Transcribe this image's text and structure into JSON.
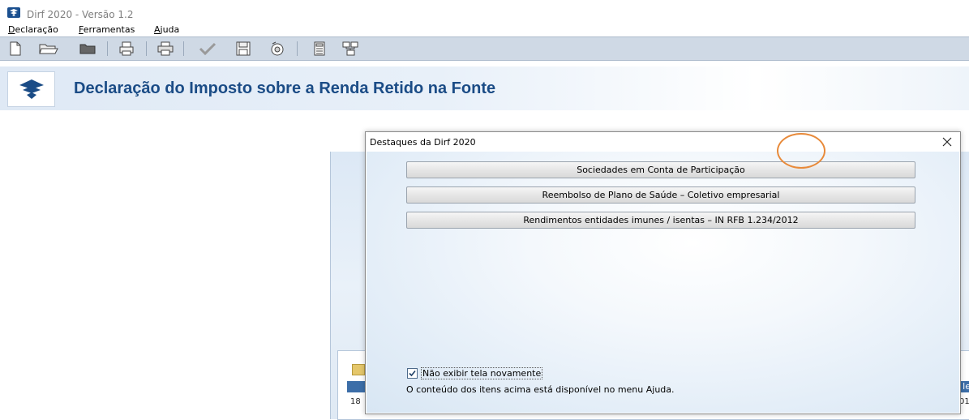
{
  "window": {
    "title": "Dirf 2020 - Versão 1.2"
  },
  "menu": {
    "items": [
      "Declaração",
      "Ferramentas",
      "Ajuda"
    ]
  },
  "toolbar": {
    "icons": [
      "new-file-icon",
      "open-folder-icon",
      "folder-icon",
      "import-icon",
      "print-icon",
      "check-icon",
      "save-icon",
      "recover-icon",
      "calculator-icon",
      "network-icon"
    ]
  },
  "banner": {
    "title": "Declaração do Imposto sobre a Renda Retido na Fonte"
  },
  "background": {
    "row_left": "18",
    "row_right": "01",
    "head_right": "le"
  },
  "dialog": {
    "title": "Destaques da Dirf 2020",
    "buttons": [
      "Sociedades em Conta de Participação",
      "Reembolso de Plano de Saúde – Coletivo empresarial",
      "Rendimentos entidades imunes / isentas – IN RFB 1.234/2012"
    ],
    "checkbox": {
      "label": "Não exibir tela novamente",
      "checked": true
    },
    "info": "O conteúdo dos itens acima está disponível no menu Ajuda."
  },
  "colors": {
    "accent": "#1b4c86",
    "annotation": "#e88a3a"
  }
}
